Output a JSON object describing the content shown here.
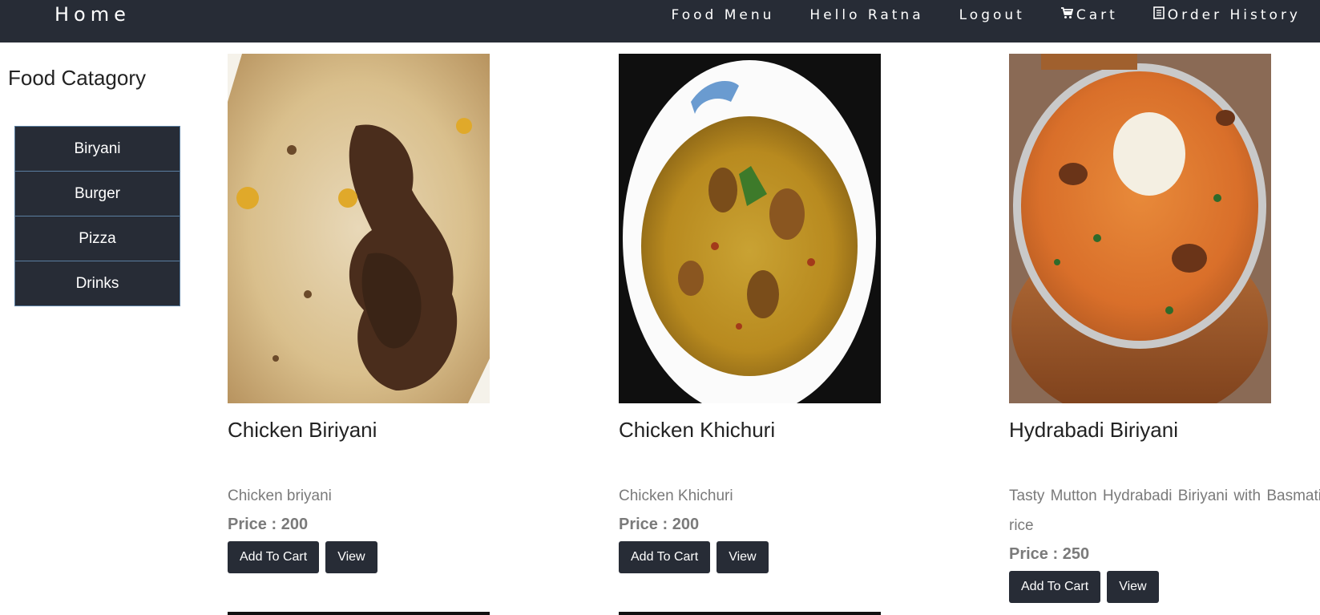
{
  "nav": {
    "home": "Home",
    "links": [
      {
        "label": "Food Menu",
        "icon": ""
      },
      {
        "label": "Hello Ratna",
        "icon": ""
      },
      {
        "label": "Logout",
        "icon": ""
      },
      {
        "label": "Cart",
        "icon": "cart-icon"
      },
      {
        "label": "Order History",
        "icon": "list-icon"
      }
    ]
  },
  "sidebar": {
    "title": "Food Catagory",
    "items": [
      "Biryani",
      "Burger",
      "Pizza",
      "Drinks"
    ]
  },
  "cards": [
    {
      "name": "Chicken Biriyani",
      "desc": "Chicken briyani",
      "price": "Price : 200",
      "add": "Add To Cart",
      "view": "View"
    },
    {
      "name": "Chicken Khichuri",
      "desc": "Chicken Khichuri",
      "price": "Price : 200",
      "add": "Add To Cart",
      "view": "View"
    },
    {
      "name": "Hydrabadi Biriyani",
      "desc": "Tasty Mutton Hydrabadi Biriyani with Basmati rice",
      "price": "Price : 250",
      "add": "Add To Cart",
      "view": "View"
    }
  ],
  "colors": {
    "navbar": "#272c36",
    "button": "#272c36",
    "category_border": "#5a7ea0"
  }
}
